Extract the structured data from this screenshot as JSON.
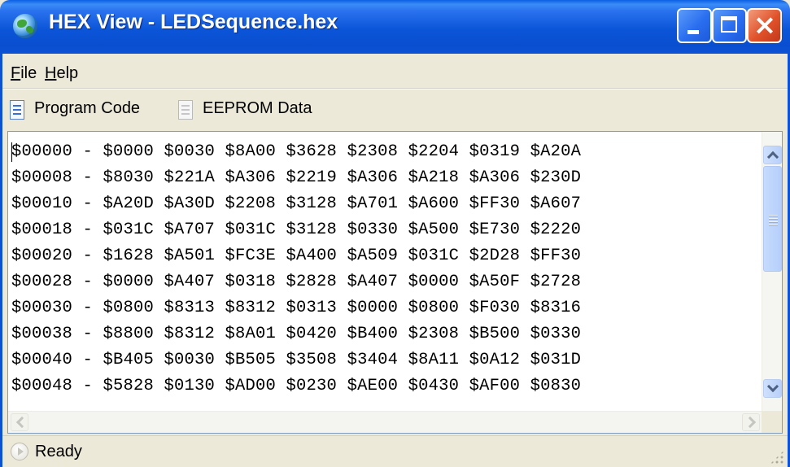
{
  "window": {
    "title": "HEX View - LEDSequence.hex",
    "controls": {
      "minimize": "minimize",
      "maximize": "maximize",
      "close": "×"
    }
  },
  "menu": {
    "file": {
      "hotkey": "F",
      "rest": "ile"
    },
    "help": {
      "hotkey": "H",
      "rest": "elp"
    }
  },
  "toolbar": {
    "program_code": "Program Code",
    "eeprom_data": "EEPROM Data"
  },
  "hex_lines": [
    "$00000 - $0000 $0030 $8A00 $3628 $2308 $2204 $0319 $A20A",
    "$00008 - $8030 $221A $A306 $2219 $A306 $A218 $A306 $230D",
    "$00010 - $A20D $A30D $2208 $3128 $A701 $A600 $FF30 $A607",
    "$00018 - $031C $A707 $031C $3128 $0330 $A500 $E730 $2220",
    "$00020 - $1628 $A501 $FC3E $A400 $A509 $031C $2D28 $FF30",
    "$00028 - $0000 $A407 $0318 $2828 $A407 $0000 $A50F $2728",
    "$00030 - $0800 $8313 $8312 $0313 $0000 $0800 $F030 $8316",
    "$00038 - $8800 $8312 $8A01 $0420 $B400 $2308 $B500 $0330",
    "$00040 - $B405 $0030 $B505 $3508 $3404 $8A11 $0A12 $031D",
    "$00048 - $5828 $0130 $AD00 $0230 $AE00 $0430 $AF00 $0830"
  ],
  "status": {
    "text": "Ready"
  },
  "icons": {
    "app": "globe-icon",
    "program_code": "document-icon",
    "eeprom_data": "document-disabled-icon",
    "status": "play-disabled-icon"
  },
  "colors": {
    "titlebar": "#0a4ed0",
    "chrome": "#ece9d8",
    "close_button": "#e0522a",
    "pane_border": "#7f9db9"
  }
}
